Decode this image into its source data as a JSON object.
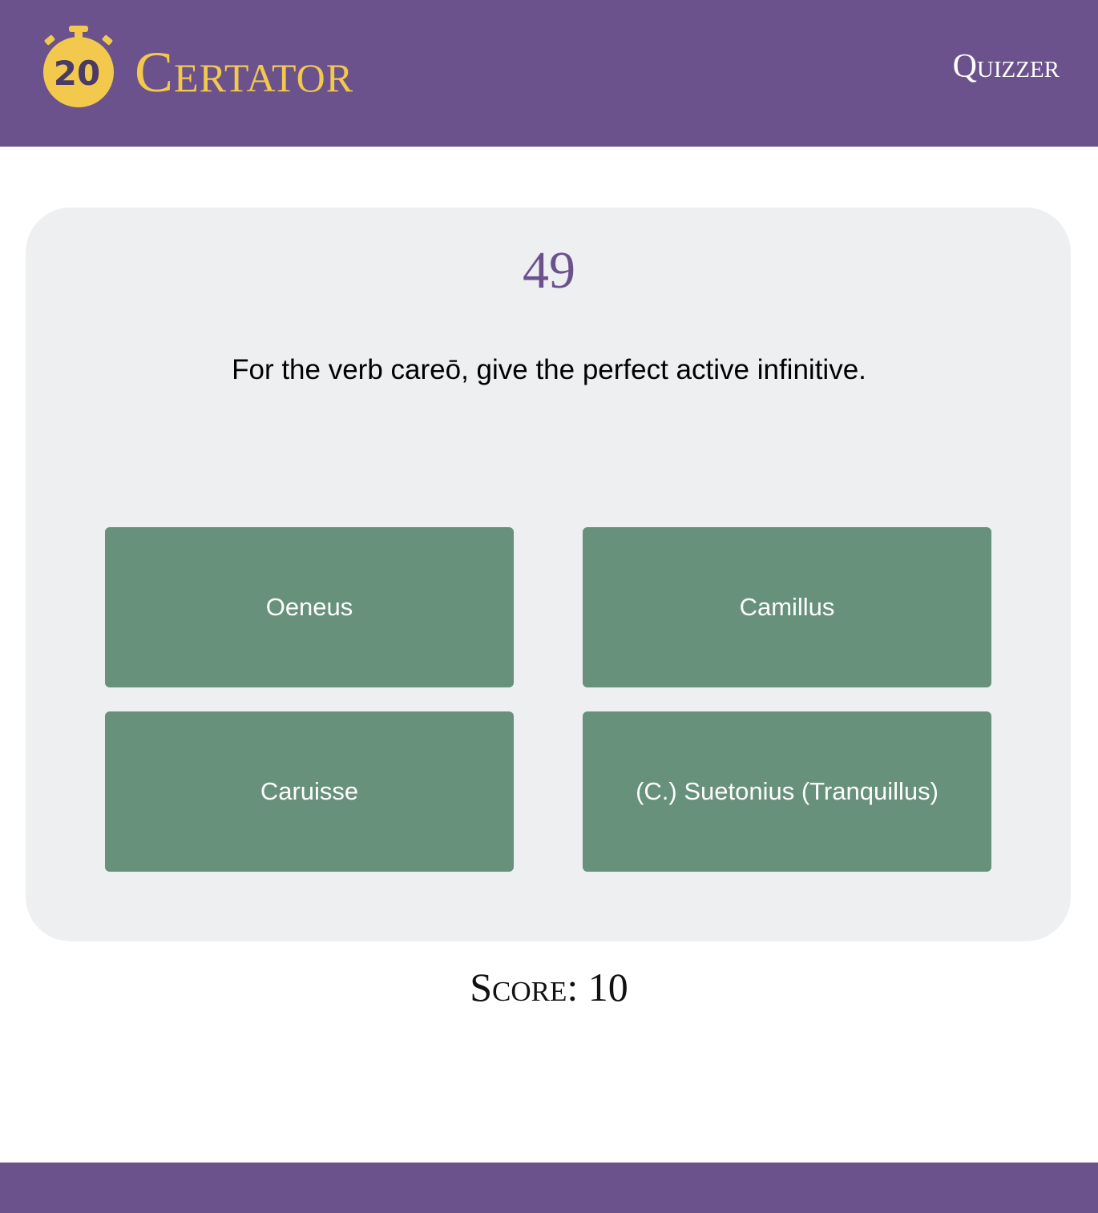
{
  "header": {
    "logo_badge": "20",
    "brand": "Certator",
    "nav_link": "Quizzer"
  },
  "quiz": {
    "question_number": "49",
    "question": "For the verb careō, give the perfect active infinitive.",
    "answers": [
      "Oeneus",
      "Camillus",
      "Caruisse",
      "(C.) Suetonius (Tranquillus)"
    ],
    "score_label": "Score:",
    "score_value": "10"
  },
  "colors": {
    "header_bg": "#6c528c",
    "brand_gold": "#f2c94c",
    "card_bg": "#eeeff1",
    "answer_bg": "#67917a"
  }
}
